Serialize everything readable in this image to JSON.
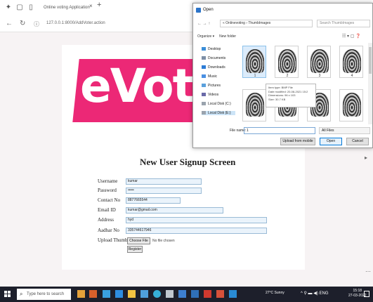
{
  "browser": {
    "tab_title": "Online voting Application",
    "tab_close": "×",
    "tab_new": "+",
    "url": "127.0.0.1:8000/AddVoter.action"
  },
  "banner": {
    "text": "eVot"
  },
  "form": {
    "title": "New User Signup Screen",
    "fields": [
      {
        "label": "Username",
        "value": "kumar"
      },
      {
        "label": "Password",
        "value": "•••••"
      },
      {
        "label": "Contact No",
        "value": "8877665544"
      },
      {
        "label": "Email ID",
        "value": "kumar@gmail.com"
      },
      {
        "label": "Address",
        "value": "hyd"
      },
      {
        "label": "Aadhar No",
        "value": "335744617946"
      }
    ],
    "upload_label": "Upload Thumb",
    "choose_file_label": "Choose File",
    "no_file_text": "No file chosen",
    "register_label": "Register"
  },
  "dialog": {
    "title": "Open",
    "path": "« Onlinevoting › ThumbImages",
    "search_placeholder": "Search ThumbImages",
    "organize_label": "Organize ▾",
    "new_folder_label": "New folder",
    "tree": [
      {
        "label": "Desktop",
        "color": "#3b8ed8"
      },
      {
        "label": "Documents",
        "color": "#7d8fa6"
      },
      {
        "label": "Downloads",
        "color": "#2c7cd6"
      },
      {
        "label": "Music",
        "color": "#4a90e2"
      },
      {
        "label": "Pictures",
        "color": "#5aa0dc"
      },
      {
        "label": "Videos",
        "color": "#6a6aa8"
      },
      {
        "label": "Local Disk (C:)",
        "color": "#9aa3ad"
      },
      {
        "label": "Local Disk (E:)",
        "color": "#9aa3ad"
      }
    ],
    "thumbs": [
      {
        "num": "1",
        "selected": true
      },
      {
        "num": "2",
        "selected": false
      },
      {
        "num": "3",
        "selected": false
      },
      {
        "num": "4",
        "selected": false
      },
      {
        "num": "",
        "selected": false
      },
      {
        "num": "",
        "selected": false
      },
      {
        "num": "",
        "selected": false
      },
      {
        "num": "",
        "selected": false
      }
    ],
    "tooltip": [
      "Item type: BMP File",
      "Date modified: 20-08-2021 15:2",
      "Dimensions: 96 x 103",
      "Size: 30.7 KB"
    ],
    "filename_label": "File name:",
    "filename_value": "1",
    "filetype_value": "All Files",
    "upload_mobile_label": "Upload from mobile",
    "open_label": "Open",
    "cancel_label": "Cancel"
  },
  "taskbar": {
    "search_placeholder": "Type here to search",
    "weather": "27°C Sunny",
    "clock_time": "15:18",
    "clock_date": "27-03-2022"
  }
}
